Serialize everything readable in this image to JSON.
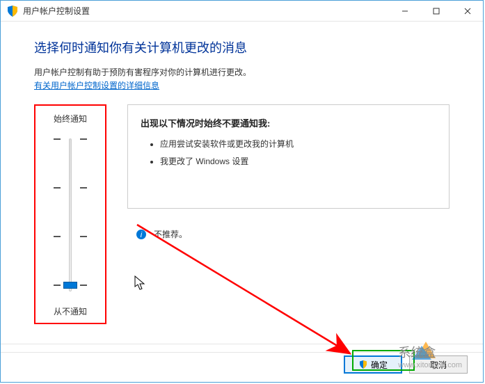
{
  "titlebar": {
    "title": "用户帐户控制设置"
  },
  "content": {
    "heading": "选择何时通知你有关计算机更改的消息",
    "description": "用户帐户控制有助于预防有害程序对你的计算机进行更改。",
    "link_text": "有关用户帐户控制设置的详细信息"
  },
  "slider": {
    "top_label": "始终通知",
    "bottom_label": "从不通知",
    "levels": 4,
    "current_level": 0
  },
  "info_panel": {
    "title": "出现以下情况时始终不要通知我:",
    "items": [
      "应用尝试安装软件或更改我的计算机",
      "我更改了 Windows 设置"
    ]
  },
  "recommendation": {
    "text": "不推荐。"
  },
  "footer": {
    "ok_label": "确定",
    "cancel_label": "取消"
  },
  "watermark": {
    "brand": "系统盒",
    "url": "www.xitonghe.com"
  }
}
